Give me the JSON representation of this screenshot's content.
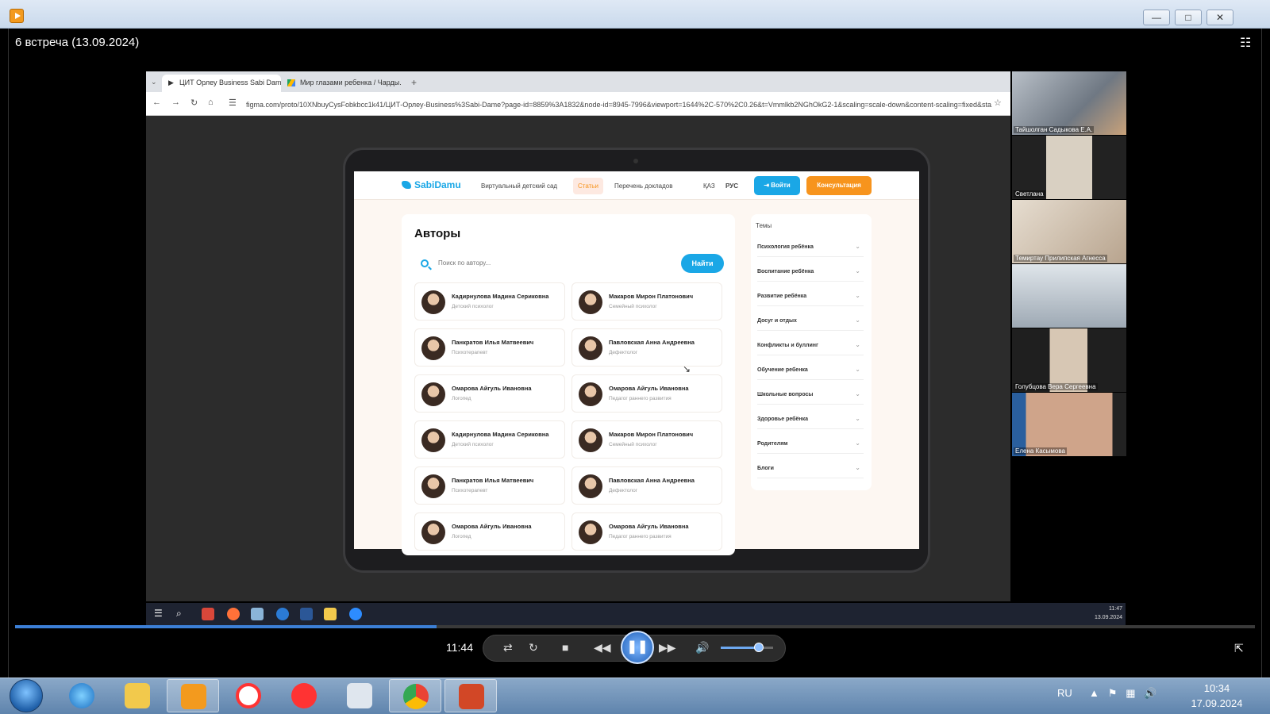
{
  "window": {
    "title": "6 встреча (13.09.2024)",
    "minimize_label": "—",
    "maximize_label": "□",
    "close_label": "✕"
  },
  "browser": {
    "tabs": [
      {
        "label": "ЦИТ Орлеу Business Sabi Dam..."
      },
      {
        "label": "Мир глазами ребенка / Чарды..."
      }
    ],
    "new_tab_label": "+",
    "url": "figma.com/proto/10XNbuyCysFobkbcc1k41/ЦИТ-Орлеу-Business%3Sabi-Dame?page-id=8859%3A1832&node-id=8945-7996&viewport=1644%2C-570%2C0.26&t=Vmmlkb2NGhOkG2-1&scaling=scale-down&content-scaling=fixed&sta..."
  },
  "site": {
    "logo": "SabiDamu",
    "nav": [
      "Виртуальный детский сад",
      "Статьи",
      "Перечень докладов"
    ],
    "lang": [
      "ҚАЗ",
      "РУС"
    ],
    "login_label": "Войти",
    "consult_label": "Консультация",
    "authors_title": "Авторы",
    "search_placeholder": "Поиск по автору...",
    "search_button": "Найти",
    "authors": [
      {
        "name": "Кадирнулова Мадина Сериковна",
        "role": "Детский психолог"
      },
      {
        "name": "Макаров Мирон Платонович",
        "role": "Семейный психолог"
      },
      {
        "name": "Панкратов Илья Матвеевич",
        "role": "Психотерапевт"
      },
      {
        "name": "Павловская Анна Андреевна",
        "role": "Дефектолог"
      },
      {
        "name": "Омарова Айгуль Ивановна",
        "role": "Логопед"
      },
      {
        "name": "Омарова Айгуль Ивановна",
        "role": "Педагог раннего развития"
      },
      {
        "name": "Кадирнулова Мадина Сериковна",
        "role": "Детский психолог"
      },
      {
        "name": "Макаров Мирон Платонович",
        "role": "Семейный психолог"
      },
      {
        "name": "Панкратов Илья Матвеевич",
        "role": "Психотерапевт"
      },
      {
        "name": "Павловская Анна Андреевна",
        "role": "Дефектолог"
      },
      {
        "name": "Омарова Айгуль Ивановна",
        "role": "Логопед"
      },
      {
        "name": "Омарова Айгуль Ивановна",
        "role": "Педагог раннего развития"
      }
    ],
    "topics_title": "Темы",
    "topics": [
      "Психология ребёнка",
      "Воспитание ребёнка",
      "Развитие ребёнка",
      "Досуг и отдых",
      "Конфликты и буллинг",
      "Обучение ребенка",
      "Школьные вопросы",
      "Здоровье ребёнка",
      "Родителям",
      "Блоги"
    ]
  },
  "remote_taskbar": {
    "clock_time": "11:47",
    "clock_date": "13.09.2024"
  },
  "participants": [
    {
      "name": "Тайшолган Садыкова Е.А."
    },
    {
      "name": "Светлана"
    },
    {
      "name": "Темиртау Прилипская Агнесса"
    },
    {
      "name": ""
    },
    {
      "name": "Голубцова Вера Сергеевна"
    },
    {
      "name": "Елена Касымова"
    }
  ],
  "player": {
    "time": "11:44",
    "progress": 0.34,
    "volume": 0.72
  },
  "taskbar": {
    "lang": "RU",
    "time": "10:34",
    "date": "17.09.2024"
  },
  "colors": {
    "accent": "#1aa7e6",
    "consult": "#f7941d",
    "player_progress": "#3c7fd6"
  }
}
